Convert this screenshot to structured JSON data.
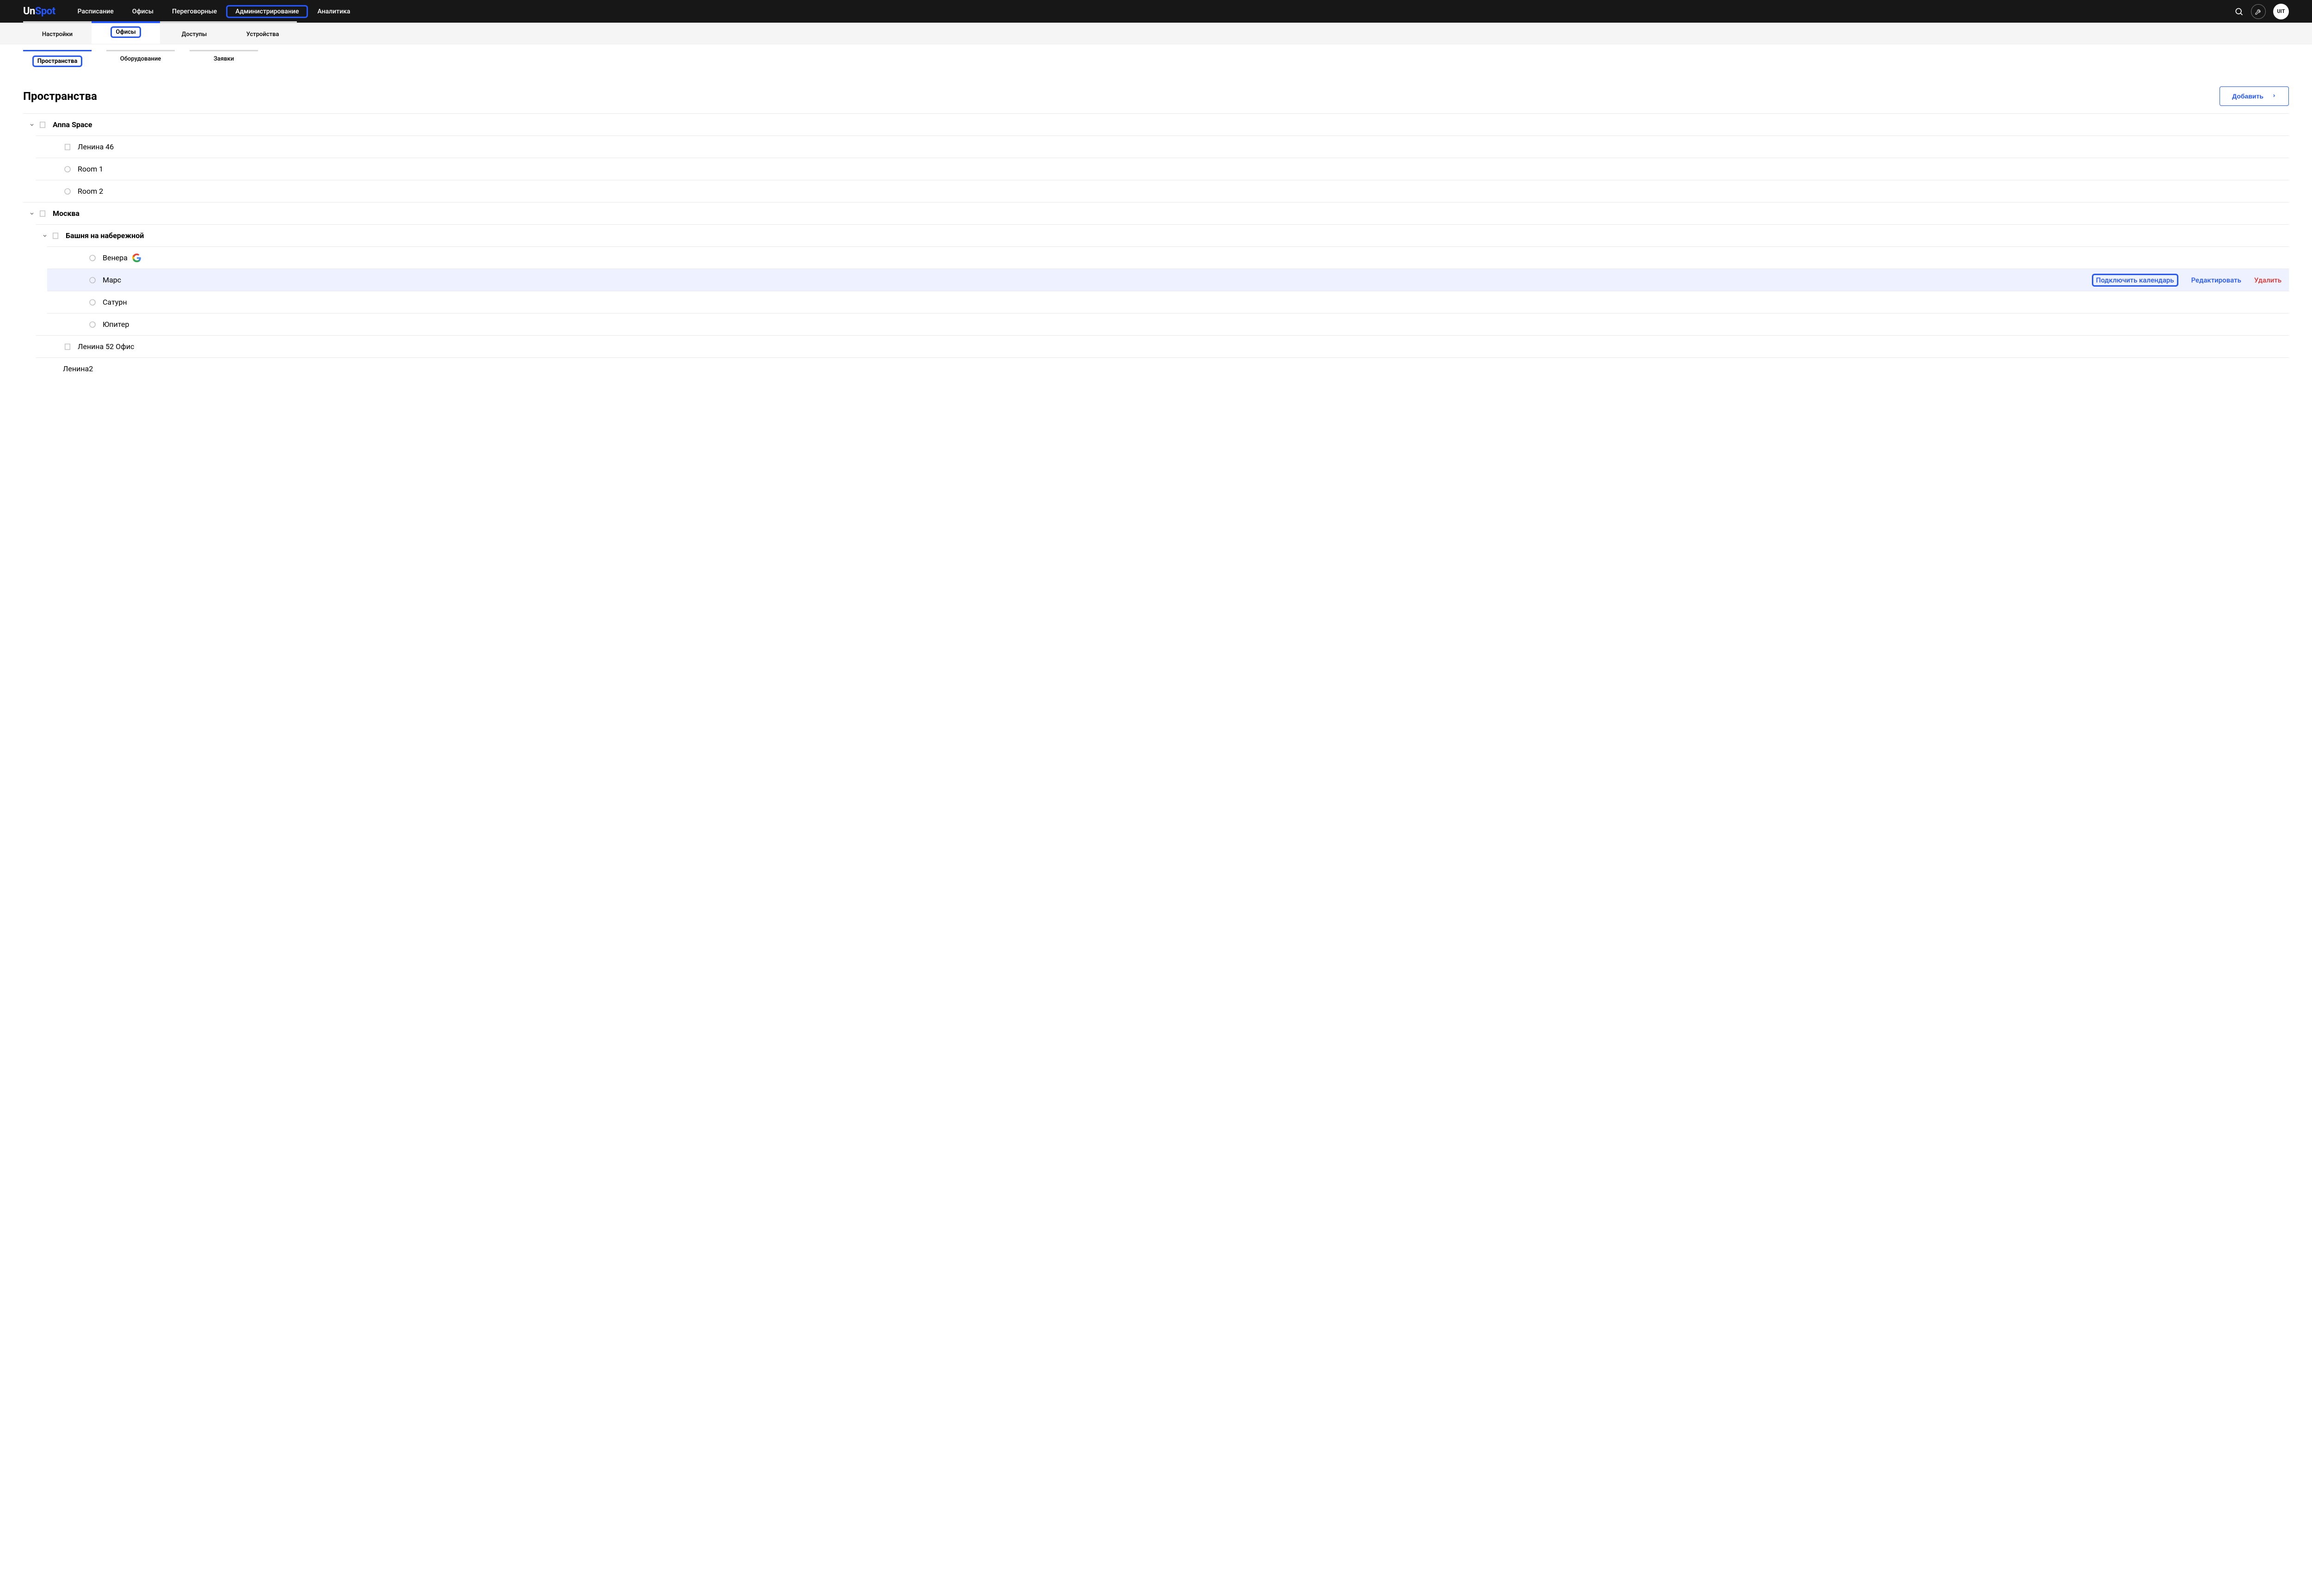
{
  "logo": {
    "part1": "Un",
    "part2": "Spot"
  },
  "nav": {
    "schedule": "Расписание",
    "offices": "Офисы",
    "meeting_rooms": "Переговорные",
    "administration": "Администрирование",
    "analytics": "Аналитика"
  },
  "avatar_text": "UIT",
  "subtabs1": {
    "settings": "Настройки",
    "offices": "Офисы",
    "access": "Доступы",
    "devices": "Устройства"
  },
  "subtabs2": {
    "spaces": "Пространства",
    "equipment": "Оборудование",
    "requests": "Заявки"
  },
  "page": {
    "title": "Пространства",
    "add_button": "Добавить"
  },
  "tree": {
    "anna_space": "Anna Space",
    "lenina46": "Ленина 46",
    "room1": "Room 1",
    "room2": "Room 2",
    "moscow": "Москва",
    "tower": "Башня на набережной",
    "venus": "Венера",
    "mars": "Марс",
    "saturn": "Сатурн",
    "jupiter": "Юпитер",
    "lenina52": "Ленина 52 Офис",
    "lenina2": "Ленина2"
  },
  "actions": {
    "connect_calendar": "Подключить календарь",
    "edit": "Редактировать",
    "delete": "Удалить"
  }
}
